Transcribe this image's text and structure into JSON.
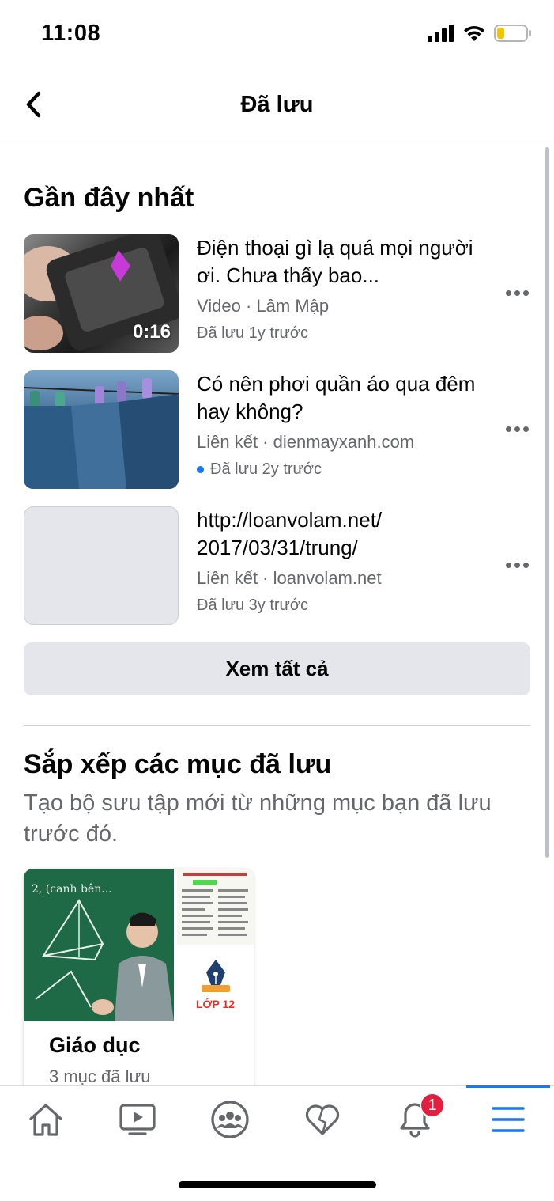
{
  "status_bar": {
    "time": "11:08"
  },
  "header": {
    "title": "Đã lưu"
  },
  "recent": {
    "title": "Gần đây nhất",
    "items": [
      {
        "title": "Điện thoại gì lạ quá mọi người ơi. Chưa thấy bao...",
        "meta": "Video · Lâm Mập",
        "saved": "Đã lưu 1y trước",
        "duration": "0:16"
      },
      {
        "title": "Có nên phơi quần áo qua đêm hay không?",
        "meta": "Liên kết · dienmayxanh.com",
        "saved": "Đã lưu 2y trước"
      },
      {
        "title": "http://loanvolam.net/ 2017/03/31/trung/",
        "meta": "Liên kết · loanvolam.net",
        "saved": "Đã lưu 3y trước"
      }
    ],
    "see_all": "Xem tất cả"
  },
  "organize": {
    "title": "Sắp xếp các mục đã lưu",
    "description": "Tạo bộ sưu tập mới từ những mục bạn đã lưu trước đó.",
    "collection": {
      "name": "Giáo dục",
      "count": "3 mục đã lưu",
      "badge": "LỚP 12"
    }
  },
  "tab_bar": {
    "notifications_badge": "1",
    "tabs": [
      "home-icon",
      "video-icon",
      "groups-icon",
      "dating-icon",
      "bell-icon",
      "menu-icon"
    ],
    "accent": "#1877f2"
  }
}
